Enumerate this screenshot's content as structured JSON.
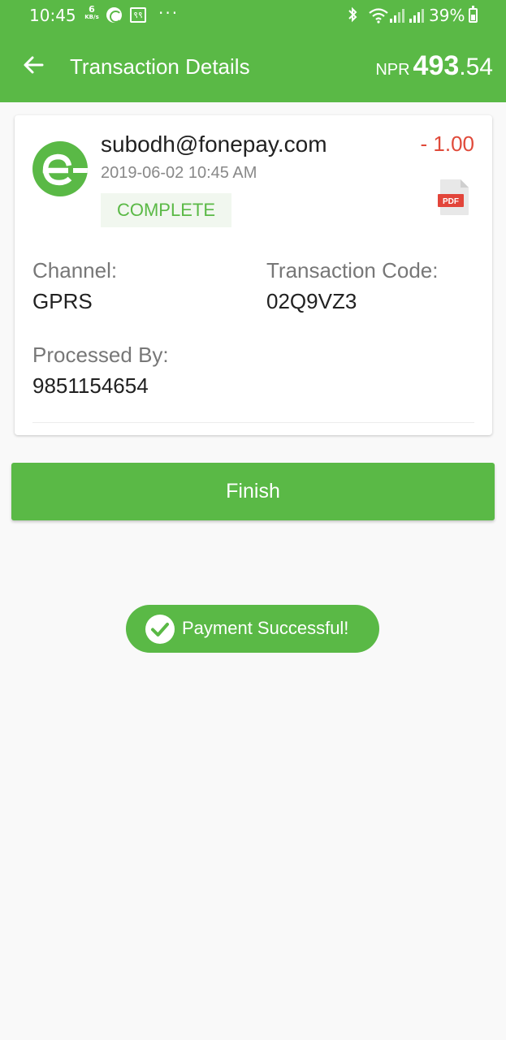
{
  "status_bar": {
    "time": "10:45",
    "net_speed_value": "6",
    "net_speed_unit": "KB/s",
    "box_icon_text": "९९",
    "more_dots": "···",
    "battery": "39%"
  },
  "app_bar": {
    "title": "Transaction Details",
    "currency": "NPR",
    "balance_int": "493",
    "balance_dec": ".54"
  },
  "transaction": {
    "merchant": "subodh@fonepay.com",
    "datetime": "2019-06-02 10:45 AM",
    "status": "COMPLETE",
    "amount": "- 1.00",
    "pdf_label": "PDF",
    "channel_label": "Channel:",
    "channel_value": "GPRS",
    "code_label": "Transaction Code:",
    "code_value": "02Q9VZ3",
    "processed_label": "Processed By:",
    "processed_value": "9851154654"
  },
  "finish_label": "Finish",
  "toast": "Payment Successful!",
  "colors": {
    "brand_green": "#5ab946",
    "debit_red": "#e04a3a",
    "badge_bg": "#f1f7ef"
  }
}
